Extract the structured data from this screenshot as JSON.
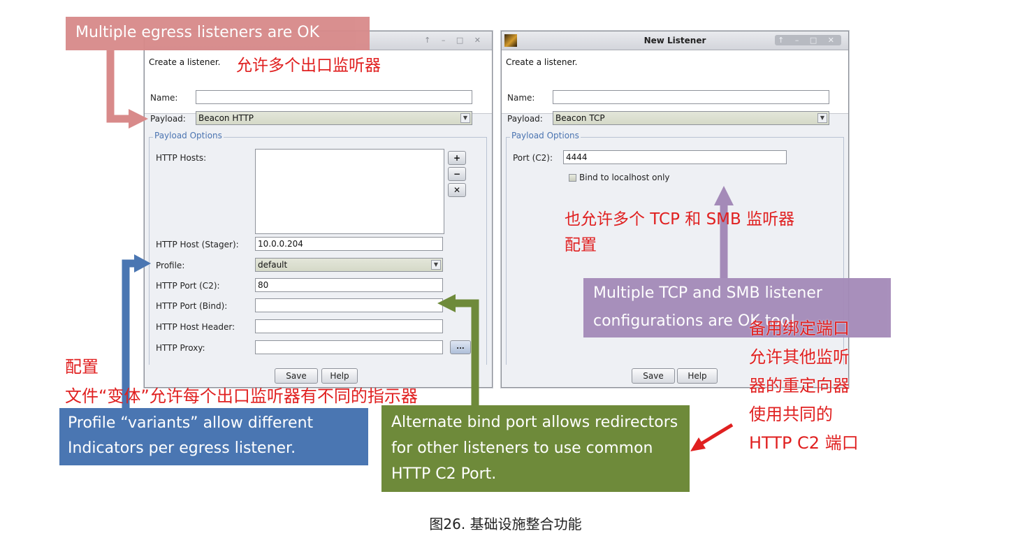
{
  "left_window": {
    "controls": "↑ – □ ✕",
    "description": "Create a listener.",
    "name_label": "Name:",
    "name_value": "",
    "payload_label": "Payload:",
    "payload_value": "Beacon HTTP",
    "payload_options_title": "Payload Options",
    "http_hosts_label": "HTTP Hosts:",
    "add_icon": "plus-icon",
    "remove_icon": "minus-icon",
    "clear_icon": "x-icon",
    "add_glyph": "+",
    "remove_glyph": "−",
    "clear_glyph": "✕",
    "stager_label": "HTTP Host (Stager):",
    "stager_value": "10.0.0.204",
    "profile_label": "Profile:",
    "profile_value": "default",
    "port_c2_label": "HTTP Port (C2):",
    "port_c2_value": "80",
    "port_bind_label": "HTTP Port (Bind):",
    "port_bind_value": "",
    "host_header_label": "HTTP Host Header:",
    "host_header_value": "",
    "proxy_label": "HTTP Proxy:",
    "proxy_value": "",
    "proxy_button": "...",
    "save_label": "Save",
    "help_label": "Help"
  },
  "right_window": {
    "title": "New Listener",
    "controls": "↑ – □ ✕",
    "description": "Create a listener.",
    "name_label": "Name:",
    "name_value": "",
    "payload_label": "Payload:",
    "payload_value": "Beacon TCP",
    "payload_options_title": "Payload Options",
    "port_label": "Port (C2):",
    "port_value": "4444",
    "bind_localhost_label": "Bind to localhost only",
    "bind_localhost_checked": false,
    "save_label": "Save",
    "help_label": "Help"
  },
  "annotations": {
    "egress_box": "Multiple egress listeners are OK",
    "egress_cn": "允许多个出口监听器",
    "tcp_smb_cn": "也允许多个 TCP 和 SMB 监听器\n配置",
    "tcp_smb_box": "Multiple TCP and SMB listener configurations are OK too!",
    "profile_cn": "配置\n文件“变体”允许每个出口监听器有不同的指示器",
    "profile_box": "Profile “variants” allow different Indicators per egress listener.",
    "bind_box": "Alternate bind port allows redirectors for other listeners to use common HTTP C2 Port.",
    "bind_cn": "备用绑定端口\n允许其他监听\n器的重定向器\n使用共同的\nHTTP C2 端口",
    "colors": {
      "pink": "#d88a8a",
      "purple": "#a48ab8",
      "blue": "#4a76b2",
      "green": "#6e8a3a",
      "red_text": "#e02020"
    }
  },
  "caption": "图26. 基础设施整合功能"
}
